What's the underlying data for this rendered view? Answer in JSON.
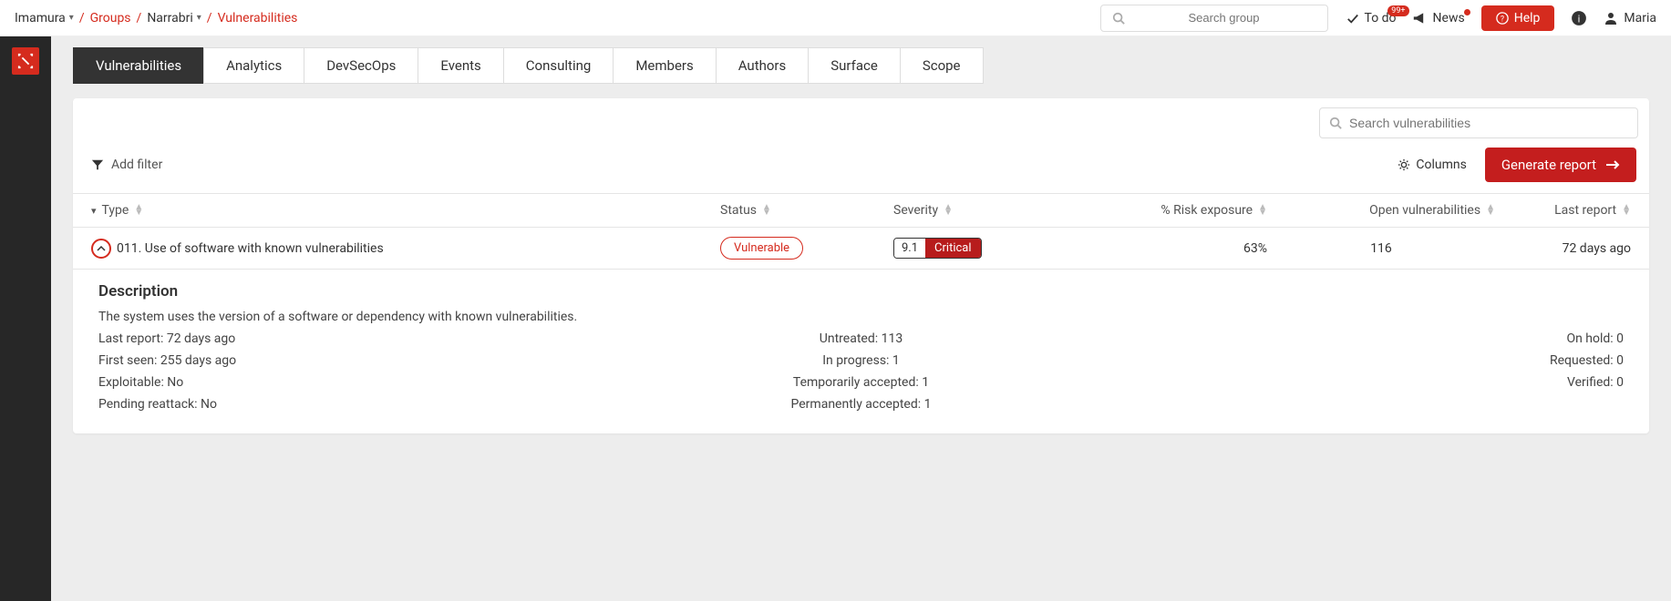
{
  "breadcrumb": {
    "item0": "Imamura",
    "item1": "Groups",
    "item2": "Narrabri",
    "item3": "Vulnerabilities"
  },
  "top_search_placeholder": "Search group",
  "top_actions": {
    "todo": "To do",
    "todo_badge": "99+",
    "news": "News",
    "help": "Help",
    "user": "Maria"
  },
  "tabs": [
    "Vulnerabilities",
    "Analytics",
    "DevSecOps",
    "Events",
    "Consulting",
    "Members",
    "Authors",
    "Surface",
    "Scope"
  ],
  "vuln_search_placeholder": "Search vulnerabilities",
  "add_filter": "Add filter",
  "columns_label": "Columns",
  "generate_report": "Generate report",
  "table": {
    "headers": {
      "type": "Type",
      "status": "Status",
      "severity": "Severity",
      "risk": "% Risk exposure",
      "open": "Open vulnerabilities",
      "last": "Last report"
    },
    "row": {
      "type": "011. Use of software with known vulnerabilities",
      "status": "Vulnerable",
      "sev_score": "9.1",
      "sev_label": "Critical",
      "risk": "63%",
      "open": "116",
      "last": "72 days ago"
    }
  },
  "detail": {
    "title": "Description",
    "description": "The system uses the version of a software or dependency with known vulnerabilities.",
    "left": {
      "last_report": "Last report: 72 days ago",
      "first_seen": "First seen: 255 days ago",
      "exploitable": "Exploitable: No",
      "pending": "Pending reattack: No"
    },
    "mid": {
      "untreated": "Untreated: 113",
      "in_progress": "In progress: 1",
      "temp_accepted": "Temporarily accepted: 1",
      "perm_accepted": "Permanently accepted: 1"
    },
    "right": {
      "on_hold": "On hold: 0",
      "requested": "Requested: 0",
      "verified": "Verified: 0"
    }
  }
}
